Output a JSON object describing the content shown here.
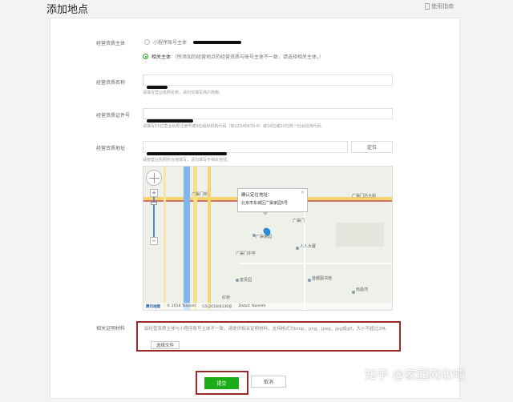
{
  "header": {
    "title": "添加地点",
    "help_link": "使用指南"
  },
  "form": {
    "subject": {
      "label": "经营资质主体",
      "options": [
        {
          "label": "小程序账号主体",
          "checked": false,
          "note": ""
        },
        {
          "label": "相关主体",
          "checked": true,
          "note": "（所添加的经营地点的经营资质与账号主体不一致，请选择相关主体。）"
        }
      ]
    },
    "name": {
      "label": "经营资质名称",
      "hint": "请填写营业执照名称，请勿仅填写商户简称。"
    },
    "license": {
      "label": "经营资质证件号",
      "hint": "请填写15位营业执照注册号或9位组织机构代码（如12345678-9）或18位或20位统一社会信用代码"
    },
    "address": {
      "label": "经营资质地址",
      "locate_button": "定位",
      "hint": "请按营业执照所在地填写，请勿填写不相关地址。"
    },
    "map": {
      "popup_title": "确认定位地址：",
      "popup_address": "北京市东城区广渠家园5号",
      "labels": [
        "广渠门桥",
        "广渠门外大街",
        "广渠家园",
        "广渠门",
        "人人大厦",
        "广渠门中学",
        "首都图书馆",
        "富贵园",
        "南昌湾",
        "红桥"
      ],
      "footer": [
        "腾讯地图",
        "© 2018 Tencent",
        "GS(2018)6336号",
        "Data© Navinfo"
      ]
    },
    "proof": {
      "label": "相关证明材料",
      "description": "如经营资质主体与小程序账号主体不一致，请提供相关证明材料，支持格式为bmp、png、jpeg、jpg或gif，大小不超过2M。",
      "select_button": "选择文件"
    }
  },
  "actions": {
    "submit": "提交",
    "cancel": "取消"
  },
  "watermark": "知乎 @家园网收吧",
  "colors": {
    "primary": "#1aad19",
    "highlight_border": "#9b2a2a"
  }
}
